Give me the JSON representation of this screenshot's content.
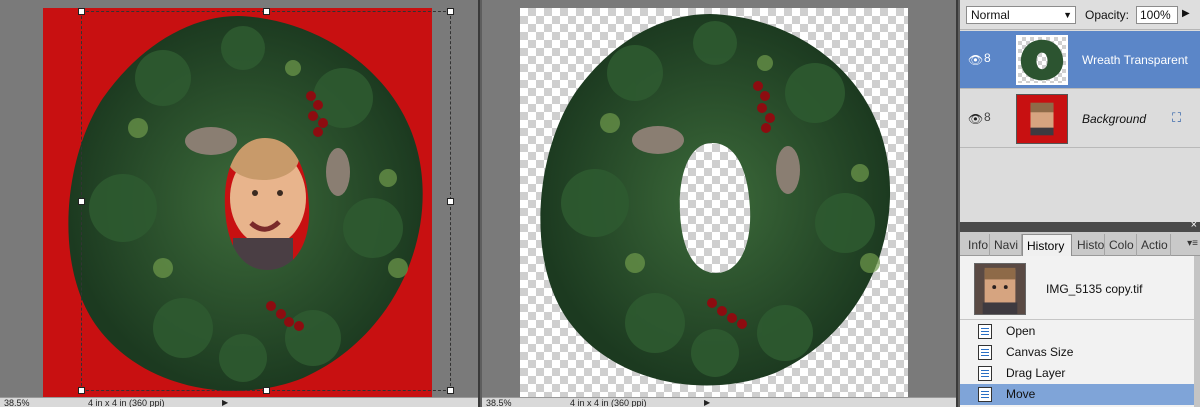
{
  "documents": [
    {
      "zoom": "38.5%",
      "dimensions": "4 in x 4 in (360 ppi)"
    },
    {
      "zoom": "38.5%",
      "dimensions": "4 in x 4 in (360 ppi)"
    }
  ],
  "layers_panel": {
    "blend_mode": "Normal",
    "opacity_label": "Opacity:",
    "opacity_value": "100%",
    "layers": [
      {
        "name": "Wreath Transparent",
        "selected": true,
        "visible": true
      },
      {
        "name": "Background",
        "selected": false,
        "visible": true
      }
    ]
  },
  "history_panel": {
    "tabs": [
      "Info",
      "Navi",
      "History",
      "Histo",
      "Colo",
      "Actio"
    ],
    "active_tab": "History",
    "snapshot_name": "IMG_5135 copy.tif",
    "items": [
      "Open",
      "Canvas Size",
      "Drag Layer",
      "Move"
    ],
    "selected_item": "Move"
  },
  "colors": {
    "background_red": "#c81011",
    "selection_blue": "#5b86c8",
    "history_selected": "#7fa4d8"
  }
}
